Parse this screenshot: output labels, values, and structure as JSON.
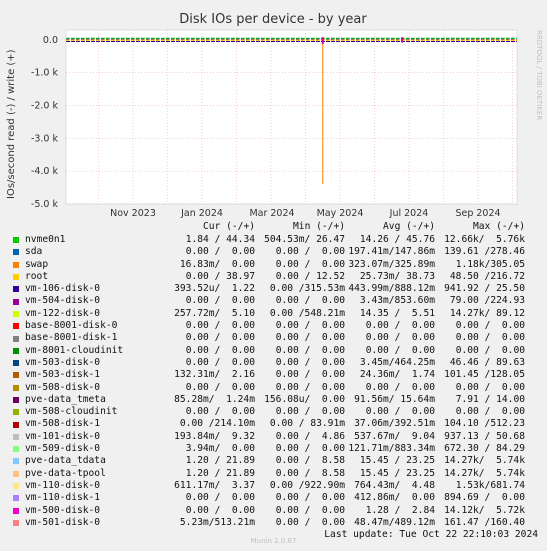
{
  "chart_data": {
    "type": "line",
    "title": "Disk IOs per device - by year",
    "ylabel": "IOs/second read (-) / write (+)",
    "side_label": "RRDTOOL / TOBI OETIKER",
    "ylim": [
      -5.0,
      0.3
    ],
    "y_ticks": [
      {
        "value": 0.0,
        "label": "0.0"
      },
      {
        "value": -1.0,
        "label": "-1.0 k"
      },
      {
        "value": -2.0,
        "label": "-2.0 k"
      },
      {
        "value": -3.0,
        "label": "-3.0 k"
      },
      {
        "value": -4.0,
        "label": "-4.0 k"
      },
      {
        "value": -5.0,
        "label": "-5.0 k"
      }
    ],
    "x_ticks": [
      "Nov 2023",
      "Jan 2024",
      "Mar 2024",
      "May 2024",
      "Jul 2024",
      "Sep 2024"
    ],
    "baseline_colors": [
      "#00cc00",
      "#0066b3",
      "#ff8000",
      "#ffcc00",
      "#330099"
    ],
    "spikes": [
      {
        "label": "swap read",
        "month": 5.5,
        "value": -4.4,
        "color": "#ff8000"
      },
      {
        "label": "vm-500-disk-0",
        "month": 5.5,
        "value": -0.12,
        "color": "#cc0099"
      },
      {
        "label": "vm-500-disk-0",
        "month": 7.8,
        "value": -0.08,
        "color": "#cc0099"
      }
    ],
    "columns": [
      "Cur (-/+)",
      "Min (-/+)",
      "Avg (-/+)",
      "Max (-/+)"
    ],
    "series": [
      {
        "name": "nvme0n1",
        "color": "#00cc00",
        "cur": "1.84 / 44.34",
        "min": "504.53m/ 26.47",
        "avg": "14.26 / 45.76",
        "max": "12.66k/  5.76k"
      },
      {
        "name": "sda",
        "color": "#0066b3",
        "cur": "0.00 /  0.00",
        "min": "0.00 /  0.00",
        "avg": "197.41m/147.86m",
        "max": "139.61 /278.46"
      },
      {
        "name": "swap",
        "color": "#ff8000",
        "cur": "16.83m/  0.00",
        "min": "0.00 /  0.00",
        "avg": "323.07m/325.89m",
        "max": "1.18k/305.05"
      },
      {
        "name": "root",
        "color": "#ffcc00",
        "cur": "0.00 / 38.97",
        "min": "0.00 / 12.52",
        "avg": "25.73m/ 38.73",
        "max": "48.50 /216.72"
      },
      {
        "name": "vm-106-disk-0",
        "color": "#330099",
        "cur": "393.52u/  1.22",
        "min": "0.00 /315.53m",
        "avg": "443.99m/888.12m",
        "max": "941.92 / 25.50"
      },
      {
        "name": "vm-504-disk-0",
        "color": "#990099",
        "cur": "0.00 /  0.00",
        "min": "0.00 /  0.00",
        "avg": "3.43m/853.60m",
        "max": "79.00 /224.93"
      },
      {
        "name": "vm-122-disk-0",
        "color": "#ccff00",
        "cur": "257.72m/  5.10",
        "min": "0.00 /548.21m",
        "avg": "14.35 /  5.51",
        "max": "14.27k/ 89.12"
      },
      {
        "name": "base-8001-disk-0",
        "color": "#ff0000",
        "cur": "0.00 /  0.00",
        "min": "0.00 /  0.00",
        "avg": "0.00 /  0.00",
        "max": "0.00 /  0.00"
      },
      {
        "name": "base-8001-disk-1",
        "color": "#808080",
        "cur": "0.00 /  0.00",
        "min": "0.00 /  0.00",
        "avg": "0.00 /  0.00",
        "max": "0.00 /  0.00"
      },
      {
        "name": "vm-8001-cloudinit",
        "color": "#008f00",
        "cur": "0.00 /  0.00",
        "min": "0.00 /  0.00",
        "avg": "0.00 /  0.00",
        "max": "0.00 /  0.00"
      },
      {
        "name": "vm-503-disk-0",
        "color": "#00487d",
        "cur": "0.00 /  0.00",
        "min": "0.00 /  0.00",
        "avg": "3.45m/464.25m",
        "max": "46.46 / 89.63"
      },
      {
        "name": "vm-503-disk-1",
        "color": "#b35a00",
        "cur": "132.31m/  2.16",
        "min": "0.00 /  0.00",
        "avg": "24.36m/  1.74",
        "max": "101.45 /128.05"
      },
      {
        "name": "vm-508-disk-0",
        "color": "#b38f00",
        "cur": "0.00 /  0.00",
        "min": "0.00 /  0.00",
        "avg": "0.00 /  0.00",
        "max": "0.00 /  0.00"
      },
      {
        "name": "pve-data_tmeta",
        "color": "#6b006b",
        "cur": "85.28m/  1.24m",
        "min": "156.08u/  0.00",
        "avg": "91.56m/ 15.64m",
        "max": "7.91 / 14.00"
      },
      {
        "name": "vm-508-cloudinit",
        "color": "#8fb300",
        "cur": "0.00 /  0.00",
        "min": "0.00 /  0.00",
        "avg": "0.00 /  0.00",
        "max": "0.00 /  0.00"
      },
      {
        "name": "vm-508-disk-1",
        "color": "#b30000",
        "cur": "0.00 /214.10m",
        "min": "0.00 / 83.91m",
        "avg": "37.06m/392.51m",
        "max": "104.10 /512.23"
      },
      {
        "name": "vm-101-disk-0",
        "color": "#bebebe",
        "cur": "193.84m/  9.32",
        "min": "0.00 /  4.86",
        "avg": "537.67m/  9.04",
        "max": "937.13 / 50.68"
      },
      {
        "name": "vm-509-disk-0",
        "color": "#80ff80",
        "cur": "3.94m/  0.00",
        "min": "0.00 /  0.00",
        "avg": "121.71m/883.34m",
        "max": "672.30 / 84.29"
      },
      {
        "name": "pve-data_tdata",
        "color": "#80c9ff",
        "cur": "1.20 / 21.89",
        "min": "0.00 /  8.58",
        "avg": "15.45 / 23.25",
        "max": "14.27k/  5.74k"
      },
      {
        "name": "pve-data-tpool",
        "color": "#ffc080",
        "cur": "1.20 / 21.89",
        "min": "0.00 /  8.58",
        "avg": "15.45 / 23.25",
        "max": "14.27k/  5.74k"
      },
      {
        "name": "vm-110-disk-0",
        "color": "#ffe680",
        "cur": "611.17m/  3.37",
        "min": "0.00 /922.90m",
        "avg": "764.43m/  4.48",
        "max": "1.53k/681.74"
      },
      {
        "name": "vm-110-disk-1",
        "color": "#aa80ff",
        "cur": "0.00 /  0.00",
        "min": "0.00 /  0.00",
        "avg": "412.86m/  0.00",
        "max": "894.69 /  0.00"
      },
      {
        "name": "vm-500-disk-0",
        "color": "#ee00cc",
        "cur": "0.00 /  0.00",
        "min": "0.00 /  0.00",
        "avg": "1.28 /  2.84",
        "max": "14.12k/  5.72k"
      },
      {
        "name": "vm-501-disk-0",
        "color": "#ff8080",
        "cur": "5.23m/513.21m",
        "min": "0.00 /  0.00",
        "avg": "48.47m/489.12m",
        "max": "161.47 /160.40"
      }
    ],
    "last_update": "Last update: Tue Oct 22 22:10:03 2024",
    "footer": "Munin 2.0.67"
  }
}
